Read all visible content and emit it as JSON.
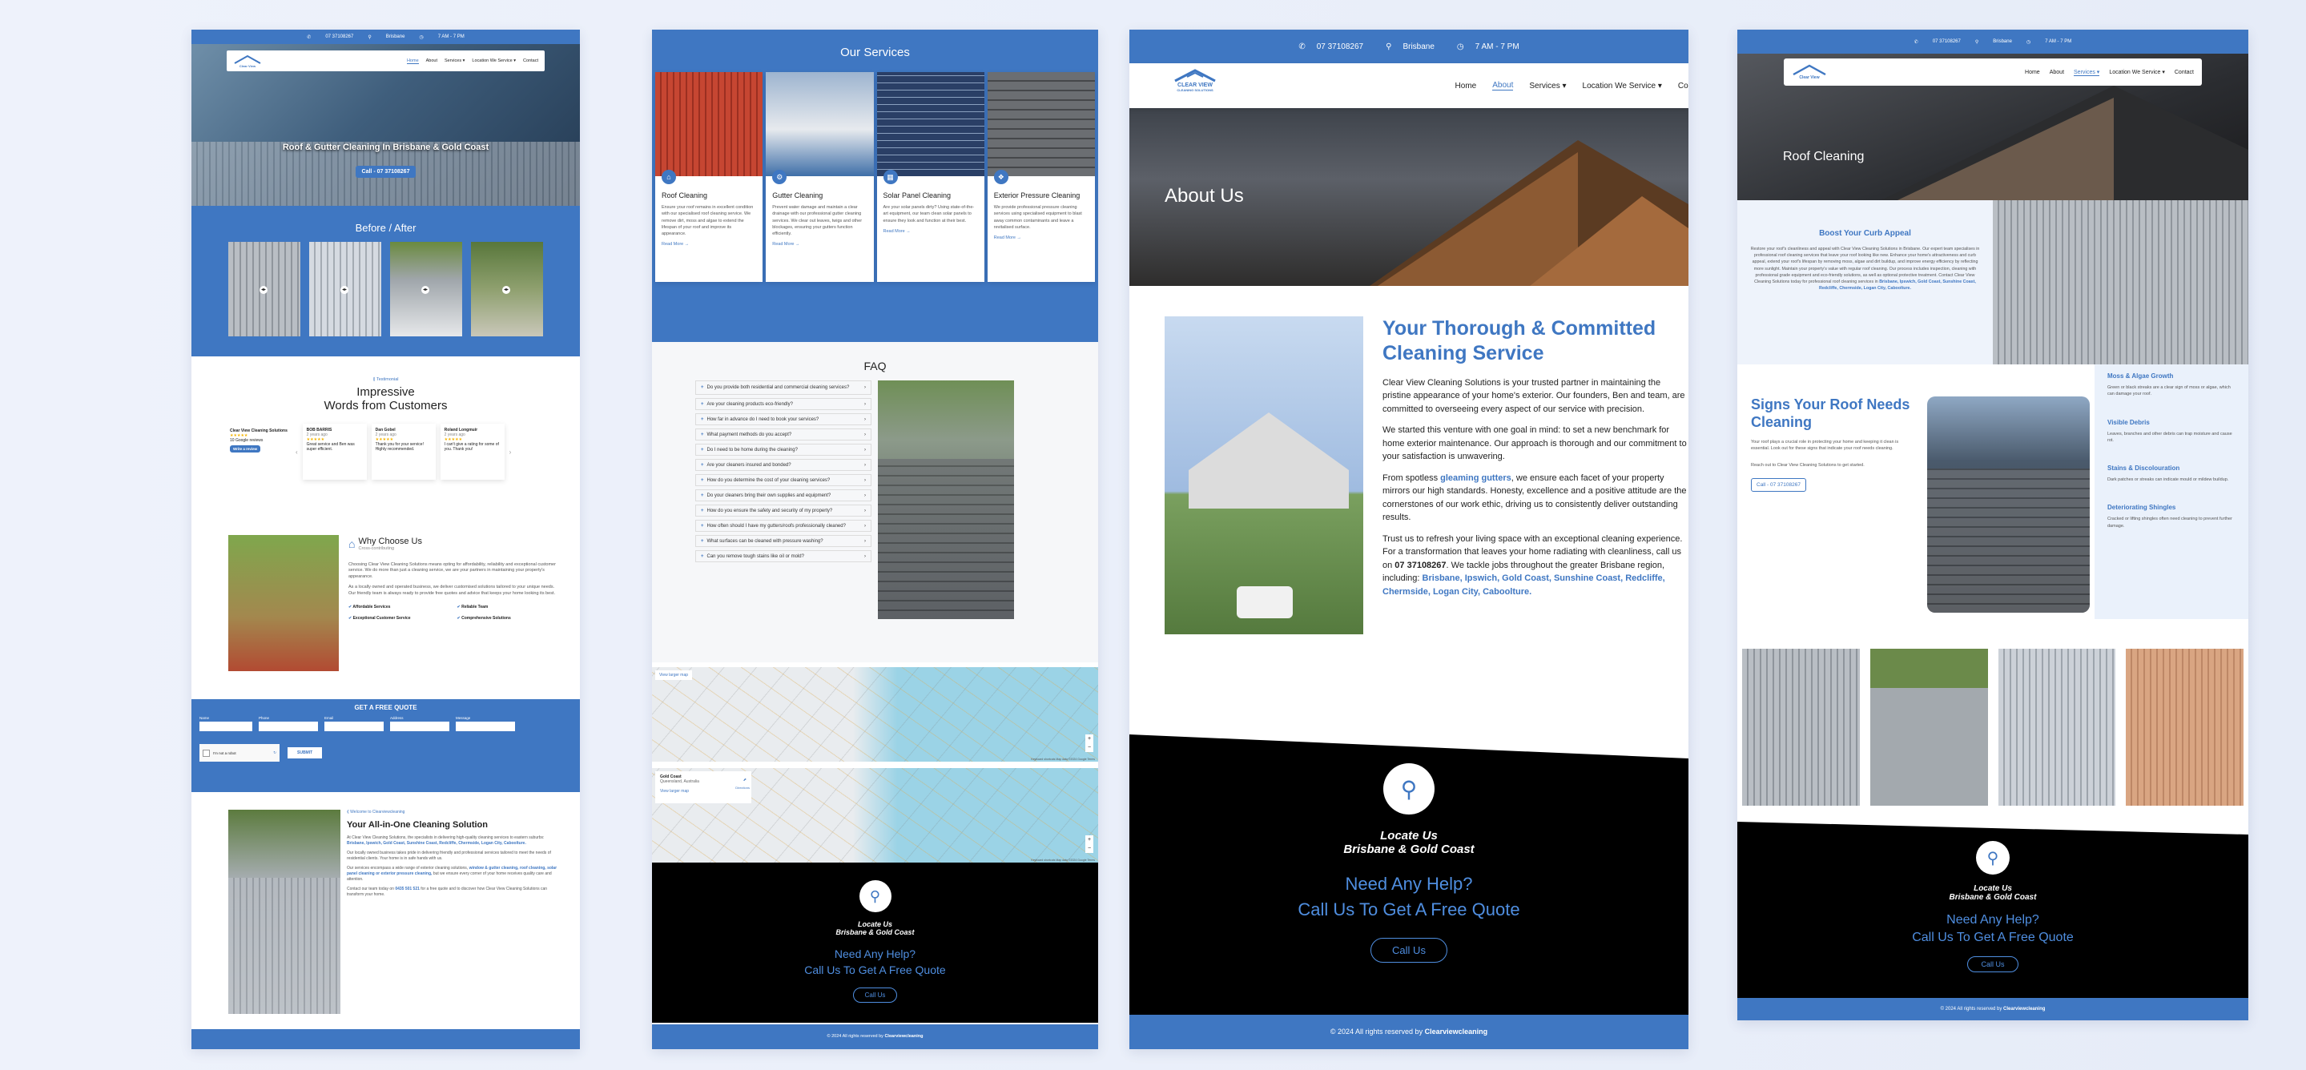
{
  "brand": {
    "primary": "#3f77c2",
    "dark": "#000000",
    "logo_top": "CLEAR VIEW",
    "logo_bottom": "CLEANING SOLUTIONS",
    "logo_small": "Clear View"
  },
  "contact": {
    "phone": "07 37108267",
    "location": "Brisbane",
    "hours": "7 AM - 7 PM"
  },
  "nav": {
    "home": "Home",
    "about": "About",
    "services": "Services",
    "location": "Location We Service",
    "contact": "Contact",
    "contact_short": "Cont"
  },
  "p1": {
    "hero_title": "Roof & Gutter Cleaning In Brisbane & Gold Coast",
    "hero_cta": "Call - 07 37108267",
    "before_after": "Before / After",
    "testimonial_tag": "Testimonial",
    "testimonial_title1": "Impressive",
    "testimonial_title2": "Words from Customers",
    "biz_name": "Clear View Cleaning Solutions",
    "biz_reviews": "10 Google reviews",
    "biz_button": "Write a review",
    "reviews": [
      {
        "name": "BOB BARRIS",
        "date": "2 years ago",
        "text": "Great service and Ben was super efficient."
      },
      {
        "name": "Dan Gobel",
        "date": "2 years ago",
        "text": "Thank you for your service! Highly recommended."
      },
      {
        "name": "Roland Longmuir",
        "date": "2 years ago",
        "text": "I can't give a rating for some of you. Thank you!"
      }
    ],
    "why_title": "Why Choose Us",
    "why_sub": "Cross-contributing",
    "why_text1": "Choosing Clear View Cleaning Solutions means opting for affordability, reliability and exceptional customer service. We do more than just a cleaning service, we are your partners in maintaining your property's appearance.",
    "why_text2": "As a locally owned and operated business, we deliver customised solutions tailored to your unique needs. Our friendly team is always ready to provide free quotes and advice that keeps your home looking its best.",
    "features": [
      "Affordable Services",
      "Reliable Team",
      "Exceptional Customer Service",
      "Comprehensive Solutions"
    ],
    "quote_title": "GET A FREE QUOTE",
    "quote_fields": [
      "Name",
      "Phone",
      "Email",
      "Address",
      "Message"
    ],
    "captcha": "I'm not a robot",
    "submit": "SUBMIT",
    "welcome_tag": "Welcome to Clearviewcleaning",
    "allinone_title": "Your All-in-One Cleaning Solution",
    "allinone_p1": "At Clear View Cleaning Solutions, the specialists in delivering high-quality cleaning services to eastern suburbs:",
    "allinone_areas": "Brisbane, Ipswich, Gold Coast, Sunshine Coast, Redcliffe, Chermside, Logan City, Caboolture.",
    "allinone_p2": "Our locally owned business takes pride in delivering friendly and professional services tailored to meet the needs of residential clients. Your home is in safe hands with us.",
    "allinone_p3a": "Our services encompass a wide range of exterior cleaning solutions, ",
    "allinone_links": "window & gutter cleaning, roof cleaning, solar panel cleaning or exterior pressure cleaning,",
    "allinone_p3b": " but we ensure every corner of your home receives quality care and attention.",
    "allinone_p4a": "Contact our team today on ",
    "allinone_phone": "0435 501 521",
    "allinone_p4b": " for a free quote and to discover how Clear View Cleaning Solutions can transform your home."
  },
  "p2": {
    "services_title": "Our Services",
    "services": [
      {
        "title": "Roof Cleaning",
        "text": "Ensure your roof remains in excellent condition with our specialised roof cleaning service. We remove dirt, moss and algae to extend the lifespan of your roof and improve its appearance."
      },
      {
        "title": "Gutter Cleaning",
        "text": "Prevent water damage and maintain a clear drainage with our professional gutter cleaning services. We clear out leaves, twigs and other blockages, ensuring your gutters function efficiently."
      },
      {
        "title": "Solar Panel Cleaning",
        "text": "Are your solar panels dirty? Using state-of-the-art equipment, our team clean solar panels to ensure they look and function at their best."
      },
      {
        "title": "Exterior Pressure Cleaning",
        "text": "We provide professional pressure cleaning services using specialised equipment to blast away common contaminants and leave a revitalised surface."
      }
    ],
    "read_more": "Read More",
    "faq_title": "FAQ",
    "faqs": [
      "Do you provide both residential and commercial cleaning services?",
      "Are your cleaning products eco-friendly?",
      "How far in advance do I need to book your services?",
      "What payment methods do you accept?",
      "Do I need to be home during the cleaning?",
      "Are your cleaners insured and bonded?",
      "How do you determine the cost of your cleaning services?",
      "Do your cleaners bring their own supplies and equipment?",
      "How do you ensure the safety and security of my property?",
      "How often should I have my gutters/roofs professionally cleaned?",
      "What surfaces can be cleaned with pressure washing?",
      "Can you remove tough stains like oil or mold?"
    ],
    "map1_link": "View larger map",
    "map2_title": "Gold Coast",
    "map2_sub": "Queensland, Australia",
    "map2_dir": "Directions",
    "map2_link": "View larger map",
    "map_credit": "Keyboard shortcuts  Map data ©2024 Google  Terms",
    "locate": "Locate Us",
    "locate_sub": "Brisbane & Gold Coast",
    "need_help": "Need Any Help?",
    "call_quote": "Call Us To Get A Free Quote",
    "call_btn": "Call Us",
    "footer_pre": "© 2024 All rights reserved by ",
    "footer_brand": "Clearviewcleaning"
  },
  "p3": {
    "hero_title": "About Us",
    "heading": "Your Thorough & Committed Cleaning Service",
    "para1": "Clear View Cleaning Solutions is your trusted partner in maintaining the pristine appearance of your home's exterior. Our founders, Ben and team, are committed to overseeing every aspect of our service with precision.",
    "para2": "We started this venture with one goal in mind: to set a new benchmark for home exterior maintenance. Our approach is thorough and our commitment to your satisfaction is unwavering.",
    "para3a": "From spotless ",
    "para3_link": "gleaming gutters",
    "para3b": ", we ensure each facet of your property mirrors our high standards. Honesty, excellence and a positive attitude are the cornerstones of our work ethic, driving us to consistently deliver outstanding results.",
    "para4a": "Trust us to refresh your living space with an exceptional cleaning experience. For a transformation that leaves your home radiating with cleanliness, call us on ",
    "para4_phone": "07 37108267",
    "para4b": ". We tackle jobs throughout the greater Brisbane region, including: ",
    "para4_areas": "Brisbane, Ipswich, Gold Coast, Sunshine Coast, Redcliffe, Chermside, Logan City, Caboolture.",
    "locate": "Locate Us",
    "locate_sub": "Brisbane & Gold Coast",
    "need_help": "Need Any Help?",
    "call_quote": "Call Us To Get A Free Quote",
    "call_btn": "Call Us",
    "footer_pre": "© 2024 All rights reserved by ",
    "footer_brand": "Clearviewcleaning"
  },
  "p4": {
    "hero_title": "Roof Cleaning",
    "boost_title": "Boost Your Curb Appeal",
    "boost_text": "Restore your roof's cleanliness and appeal with Clear View Cleaning Solutions in Brisbane. Our expert team specialises in professional roof cleaning services that leave your roof looking like new. Enhance your home's attractiveness and curb appeal, extend your roof's lifespan by removing moss, algae and dirt buildup, and improve energy efficiency by reflecting more sunlight. Maintain your property's value with regular roof cleaning. Our process includes inspection, cleaning with professional grade equipment and eco-friendly solutions, as well as optional protective treatment. Contact Clear View Cleaning Solutions today for professional roof cleaning services in ",
    "boost_areas": "Brisbane, Ipswich, Gold Coast, Sunshine Coast, Redcliffe, Chermside, Logan City, Caboolture.",
    "signs_title": "Signs Your Roof Needs Cleaning",
    "signs_text1": "Your roof plays a crucial role in protecting your home and keeping it clean is essential. Look out for these signs that indicate your roof needs cleaning.",
    "signs_text2": "Reach out to Clear View Cleaning Solutions to get started.",
    "signs_btn": "Call - 07 37108267",
    "signs": [
      {
        "title": "Moss & Algae Growth",
        "text": "Green or black streaks are a clear sign of moss or algae, which can damage your roof."
      },
      {
        "title": "Visible Debris",
        "text": "Leaves, branches and other debris can trap moisture and cause rot."
      },
      {
        "title": "Stains & Discolouration",
        "text": "Dark patches or streaks can indicate mould or mildew buildup."
      },
      {
        "title": "Deteriorating Shingles",
        "text": "Cracked or lifting shingles often need cleaning to prevent further damage."
      }
    ],
    "locate": "Locate Us",
    "locate_sub": "Brisbane & Gold Coast",
    "need_help": "Need Any Help?",
    "call_quote": "Call Us To Get A Free Quote",
    "call_btn": "Call Us",
    "footer_pre": "© 2024 All rights reserved by ",
    "footer_brand": "Clearviewcleaning"
  }
}
